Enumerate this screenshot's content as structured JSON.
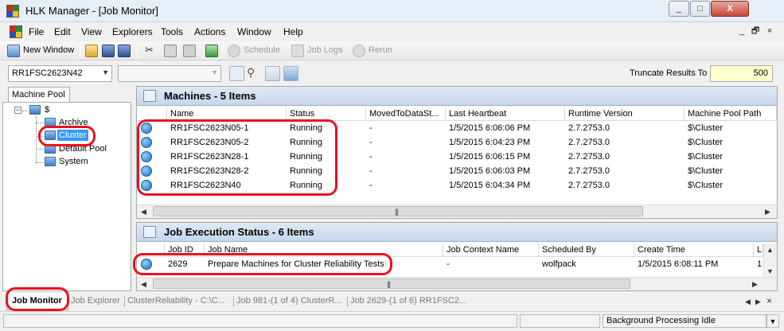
{
  "window": {
    "title": "HLK Manager - [Job Monitor]",
    "controls": [
      "_",
      "□",
      "X"
    ],
    "mdi_controls": [
      "_",
      "🗗",
      "×"
    ]
  },
  "menu": [
    "File",
    "Edit",
    "View",
    "Explorers",
    "Tools",
    "Actions",
    "Window",
    "Help"
  ],
  "toolbar": {
    "new_window": "New Window",
    "schedule": "Schedule",
    "job_logs": "Job Logs",
    "rerun": "Rerun"
  },
  "filter": {
    "machine_combo": "RR1FSC2623N42",
    "second_combo": "",
    "truncate_label": "Truncate Results To",
    "truncate_value": "500"
  },
  "left_pane": {
    "tab": "Machine Pool",
    "tree": {
      "root": "$",
      "children": [
        "Archive",
        "Cluster",
        "Default Pool",
        "System"
      ],
      "selected": "Cluster"
    }
  },
  "machines_panel": {
    "title": "Machines - 5 Items",
    "columns": [
      "Name",
      "Status",
      "MovedToDataSt...",
      "Last Heartbeat",
      "Runtime Version",
      "Machine Pool Path"
    ],
    "rows": [
      {
        "name": "RR1FSC2623N05-1",
        "status": "Running",
        "moved": "-",
        "heartbeat": "1/5/2015 6:06:06 PM",
        "runtime": "2.7.2753.0",
        "pool": "$\\Cluster"
      },
      {
        "name": "RR1FSC2623N05-2",
        "status": "Running",
        "moved": "-",
        "heartbeat": "1/5/2015 6:04:23 PM",
        "runtime": "2.7.2753.0",
        "pool": "$\\Cluster"
      },
      {
        "name": "RR1FSC2623N28-1",
        "status": "Running",
        "moved": "-",
        "heartbeat": "1/5/2015 6:06:15 PM",
        "runtime": "2.7.2753.0",
        "pool": "$\\Cluster"
      },
      {
        "name": "RR1FSC2623N28-2",
        "status": "Running",
        "moved": "-",
        "heartbeat": "1/5/2015 6:06:03 PM",
        "runtime": "2.7.2753.0",
        "pool": "$\\Cluster"
      },
      {
        "name": "RR1FSC2623N40",
        "status": "Running",
        "moved": "-",
        "heartbeat": "1/5/2015 6:04:34 PM",
        "runtime": "2.7.2753.0",
        "pool": "$\\Cluster"
      }
    ]
  },
  "jobs_panel": {
    "title": "Job Execution Status - 6 Items",
    "columns": [
      "Job ID",
      "Job Name",
      "Job Context Name",
      "Scheduled By",
      "Create Time",
      "L"
    ],
    "rows": [
      {
        "id": "2629",
        "name": "Prepare Machines for Cluster Reliability Tests",
        "context": "-",
        "scheduled_by": "wolfpack",
        "create_time": "1/5/2015 6:08:11 PM",
        "last": "1"
      }
    ]
  },
  "bottom_tabs": {
    "active": "Job Monitor",
    "others": [
      "Job Explorer",
      "ClusterReliability - C:\\C...",
      "Job 981-(1 of 4) ClusterR...",
      "Job 2629-(1 of 6) RR1FSC2..."
    ]
  },
  "status_bar": {
    "text": "Background Processing Idle"
  },
  "colors": {
    "highlight_oval": "#e8121f",
    "panel_header": "#c6d6ea",
    "selection": "#3399ff",
    "truncate_bg": "#ffffcc"
  }
}
